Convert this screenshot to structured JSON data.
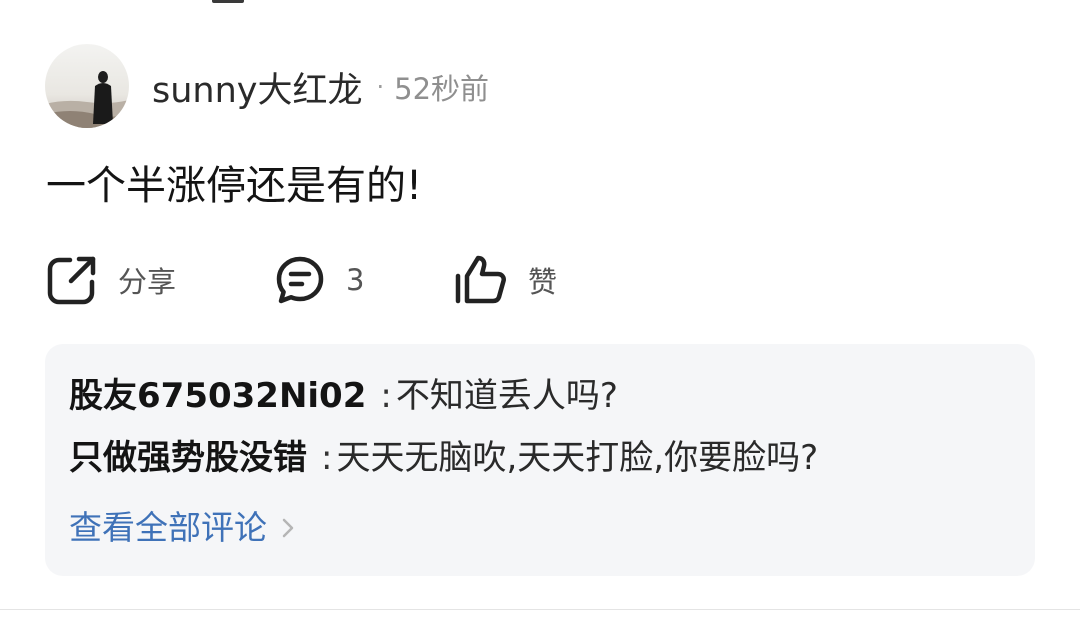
{
  "post": {
    "author_name": "sunny大红龙",
    "separator": "·",
    "time_ago": "52秒前",
    "text": "一个半涨停还是有的!"
  },
  "actions": {
    "share_label": "分享",
    "comment_count": "3",
    "like_label": "赞"
  },
  "comments": [
    {
      "user": "股友675032Ni02",
      "colon": ":",
      "text": "不知道丢人吗?"
    },
    {
      "user": "只做强势股没错",
      "colon": ":",
      "text": "天天无脑吹,天天打脸,你要脸吗?"
    }
  ],
  "view_all_label": "查看全部评论",
  "colors": {
    "link": "#3f72b8",
    "comment_bg": "#f5f6f8",
    "muted_text": "#8f8f8f"
  },
  "icons": {
    "share": "share-icon",
    "comment": "comment-bubble-icon",
    "like": "thumbs-up-icon",
    "chevron": "chevron-right-icon"
  }
}
